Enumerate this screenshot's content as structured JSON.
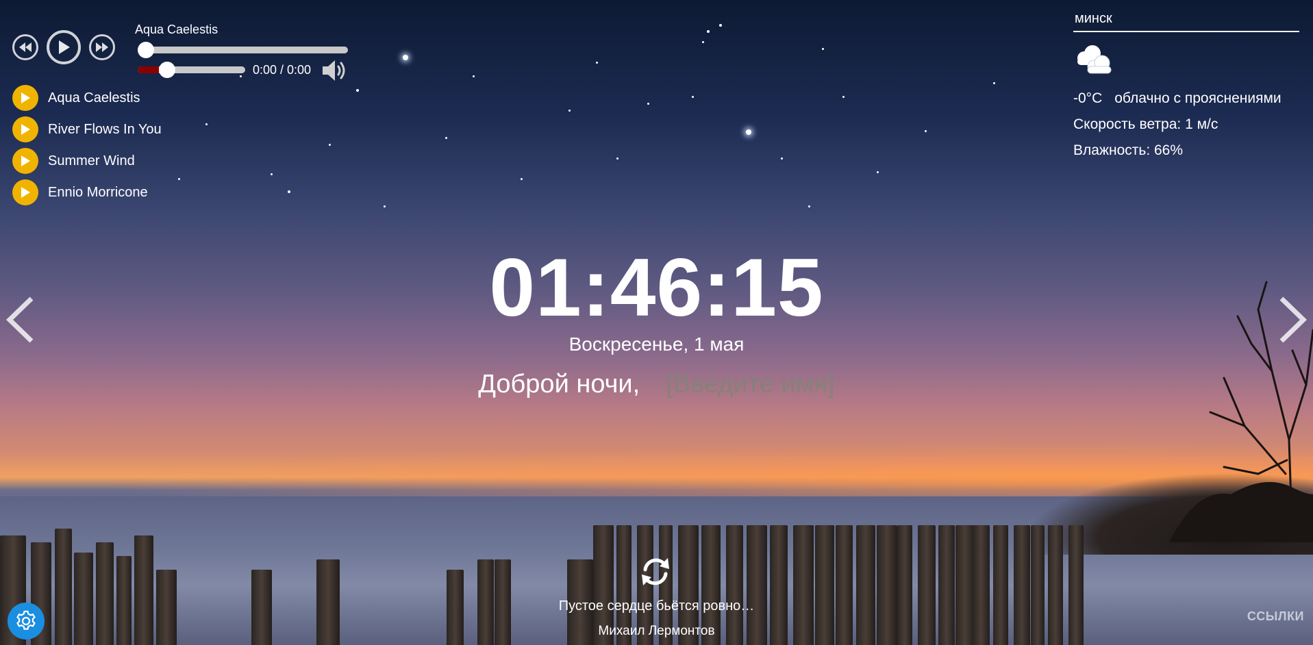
{
  "player": {
    "now_playing": "Aqua Caelestis",
    "time": "0:00 / 0:00",
    "progress": 0,
    "volume": 0.2,
    "playlist": [
      {
        "title": "Aqua Caelestis"
      },
      {
        "title": "River Flows In You"
      },
      {
        "title": "Summer Wind"
      },
      {
        "title": "Ennio Morricone"
      }
    ]
  },
  "weather": {
    "city": "минск",
    "icon": "partly-cloudy-icon",
    "temperature": "-0°C",
    "description": "облачно с прояснениями",
    "wind": "Скорость ветра: 1 м/с",
    "humidity": "Влажность: 66%"
  },
  "clock": {
    "time": "01:46:15",
    "date": "Воскресенье, 1 мая",
    "greeting": "Доброй ночи,",
    "name_placeholder": "[Введите имя]"
  },
  "quote": {
    "text": "Пустое сердце бьётся ровно…",
    "author": "Михаил Лермонтов"
  },
  "footer": {
    "links_label": "ССЫЛКИ"
  },
  "colors": {
    "accent_playlist": "#f0b400",
    "settings_button": "#1a8ee0",
    "volume_fill": "#8b0000"
  }
}
